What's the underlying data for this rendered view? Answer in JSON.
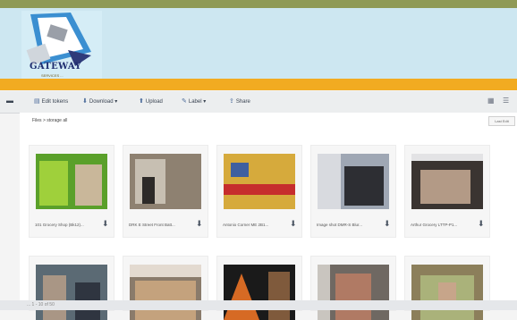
{
  "header": {
    "logo_text": "GATEWAY",
    "logo_tagline": "SERVICES ..."
  },
  "toolbar": {
    "items": [
      {
        "label": "Edit tokens",
        "icon": "edit-icon"
      },
      {
        "label": "Download ▾",
        "icon": "download-icon"
      },
      {
        "label": "Upload",
        "icon": "upload-icon"
      },
      {
        "label": "Label ▾",
        "icon": "tag-icon"
      },
      {
        "label": "Share",
        "icon": "share-icon"
      }
    ],
    "right_icons": [
      "grid-view-icon",
      "list-view-icon"
    ]
  },
  "breadcrumb": "Files  >  storage all",
  "sort_button": "Last Edit",
  "images": [
    {
      "caption": "101 Grocery Shop (Bk12)...",
      "colors": [
        "#5aa02a",
        "#9fd03b",
        "#c9b79a"
      ]
    },
    {
      "caption": "DRK E Street Front Batt...",
      "colors": [
        "#8e8171",
        "#c7bfb2",
        "#2d2a28"
      ]
    },
    {
      "caption": "Antonio Corner ME 2B1...",
      "colors": [
        "#d6aa3c",
        "#c62d2d",
        "#3f5fa0"
      ]
    },
    {
      "caption": "Image shot DMR-S Blur...",
      "colors": [
        "#9fa7b4",
        "#2d2e33",
        "#d8dadf"
      ]
    },
    {
      "caption": "Arthur Grocery LTTP-P1...",
      "colors": [
        "#3a3431",
        "#b39a86",
        "#e3e3e5"
      ]
    },
    {
      "caption": "",
      "colors": [
        "#5b6a74",
        "#a99685",
        "#2f3540"
      ]
    },
    {
      "caption": "",
      "colors": [
        "#8a7b6b",
        "#c4a27d",
        "#e3dad0"
      ]
    },
    {
      "caption": "",
      "colors": [
        "#d66a24",
        "#1a1a1a",
        "#7f5a3c"
      ]
    },
    {
      "caption": "",
      "colors": [
        "#6f6862",
        "#b07a64",
        "#c9c5bf"
      ]
    },
    {
      "caption": "",
      "colors": [
        "#8c7f5b",
        "#aab27a",
        "#c7a58a"
      ]
    }
  ],
  "footer": "... 1 - 10 of 50"
}
